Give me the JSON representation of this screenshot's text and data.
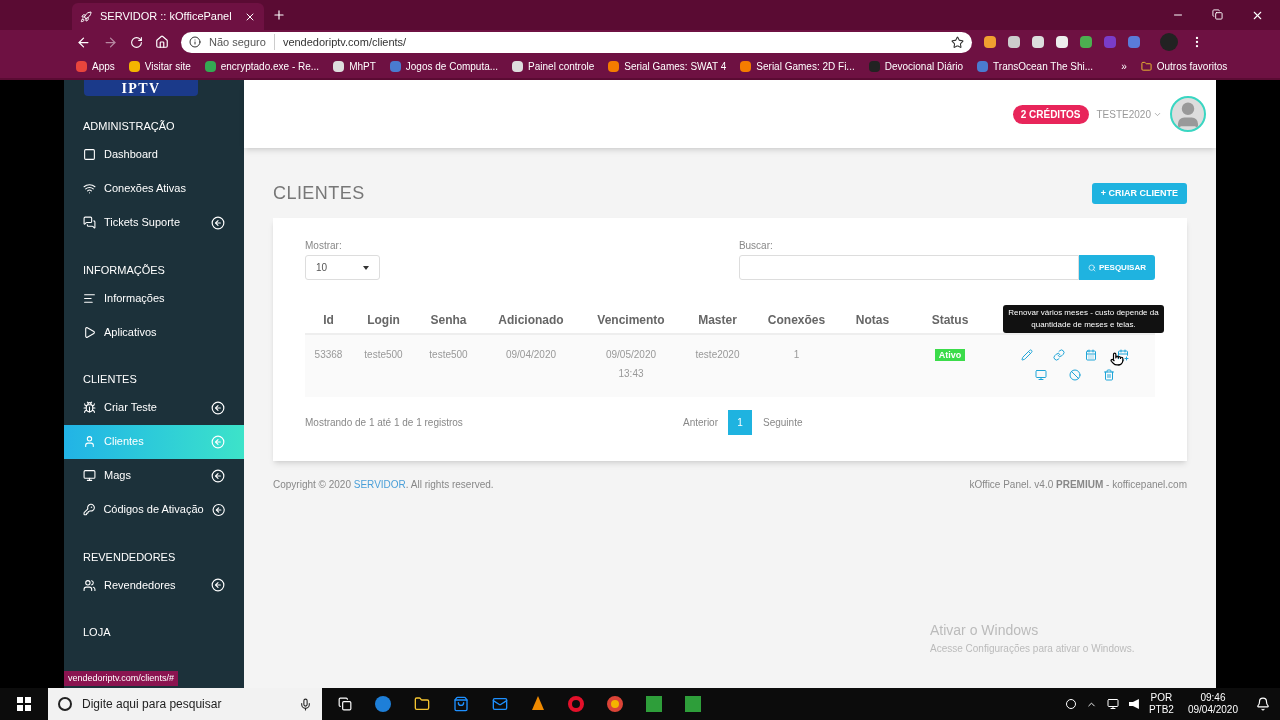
{
  "browser": {
    "tab_title": "SERVIDOR :: kOfficePanel",
    "security": "Não seguro",
    "url": "vendedoriptv.com/clients/",
    "bookmarks": [
      {
        "label": "Apps",
        "color": "#e8453c"
      },
      {
        "label": "Visitar site",
        "color": "#f4b400"
      },
      {
        "label": "encryptado.exe - Re...",
        "color": "#34a853"
      },
      {
        "label": "MhPT",
        "color": "#dddddd"
      },
      {
        "label": "Jogos de Computa...",
        "color": "#4a7bd0"
      },
      {
        "label": "Painel controle",
        "color": "#dddddd"
      },
      {
        "label": "Serial Games: SWAT 4",
        "color": "#f57c00"
      },
      {
        "label": "Serial Games: 2D Fi...",
        "color": "#f57c00"
      },
      {
        "label": "Devocional Diário",
        "color": "#222222"
      },
      {
        "label": "TransOcean The Shi...",
        "color": "#4a7bd0"
      }
    ],
    "more": "»",
    "other_bookmarks": "Outros favoritos",
    "status_link": "vendedoriptv.com/clients/#"
  },
  "sidebar": {
    "logo": "IPTV",
    "sections": [
      {
        "title": "ADMINISTRAÇÃO",
        "items": [
          {
            "label": "Dashboard",
            "expandable": false,
            "selected": false
          },
          {
            "label": "Conexões Ativas",
            "expandable": false,
            "selected": false
          },
          {
            "label": "Tickets Suporte",
            "expandable": true,
            "selected": false
          }
        ]
      },
      {
        "title": "INFORMAÇÕES",
        "items": [
          {
            "label": "Informações",
            "expandable": false,
            "selected": false
          },
          {
            "label": "Aplicativos",
            "expandable": false,
            "selected": false
          }
        ]
      },
      {
        "title": "CLIENTES",
        "items": [
          {
            "label": "Criar Teste",
            "expandable": true,
            "selected": false
          },
          {
            "label": "Clientes",
            "expandable": true,
            "selected": true
          },
          {
            "label": "Mags",
            "expandable": true,
            "selected": false
          },
          {
            "label": "Códigos de Ativação",
            "expandable": true,
            "selected": false
          }
        ]
      },
      {
        "title": "REVENDEDORES",
        "items": [
          {
            "label": "Revendedores",
            "expandable": true,
            "selected": false
          }
        ]
      },
      {
        "title": "LOJA"
      }
    ]
  },
  "header": {
    "credits": "2 CRÉDITOS",
    "user": "TESTE2020"
  },
  "page": {
    "title": "CLIENTES",
    "create_button": "+ CRIAR CLIENTE",
    "show_label": "Mostrar:",
    "show_value": "10",
    "search_label": "Buscar:",
    "search_button": "PESQUISAR",
    "columns": [
      "Id",
      "Login",
      "Senha",
      "Adicionado",
      "Vencimento",
      "Master",
      "Conexões",
      "Notas",
      "Status"
    ],
    "rows": [
      {
        "cells": [
          "53368",
          "teste500",
          "teste500",
          "09/04/2020"
        ],
        "due": [
          "09/05/2020",
          "13:43"
        ],
        "master": "teste2020",
        "connections": "1",
        "status": "Ativo",
        "active": true
      }
    ],
    "tooltip": "Renovar vários meses - custo depende da quantidade de meses e telas.",
    "info": "Mostrando de 1 até 1 de 1 registros",
    "pagination": {
      "prev": "Anterior",
      "pages": [
        {
          "label": "1",
          "selected": true
        }
      ],
      "next": "Seguinte"
    }
  },
  "footer": {
    "copyright_before": "Copyright © 2020",
    "copyright_link": "SERVIDOR",
    "copyright_after": ". All rights reserved.",
    "version": "kOffice Panel. v4.0 **PREMIUM** - kofficepanel.com"
  },
  "windows_notice": {
    "title": "Ativar o Windows",
    "text": "Acesse Configurações para ativar o Windows."
  },
  "taskbar": {
    "search": "Digite aqui para pesquisar",
    "lang": "POR",
    "layout": "PTB2",
    "time": "09:46",
    "date": "09/04/2020"
  }
}
